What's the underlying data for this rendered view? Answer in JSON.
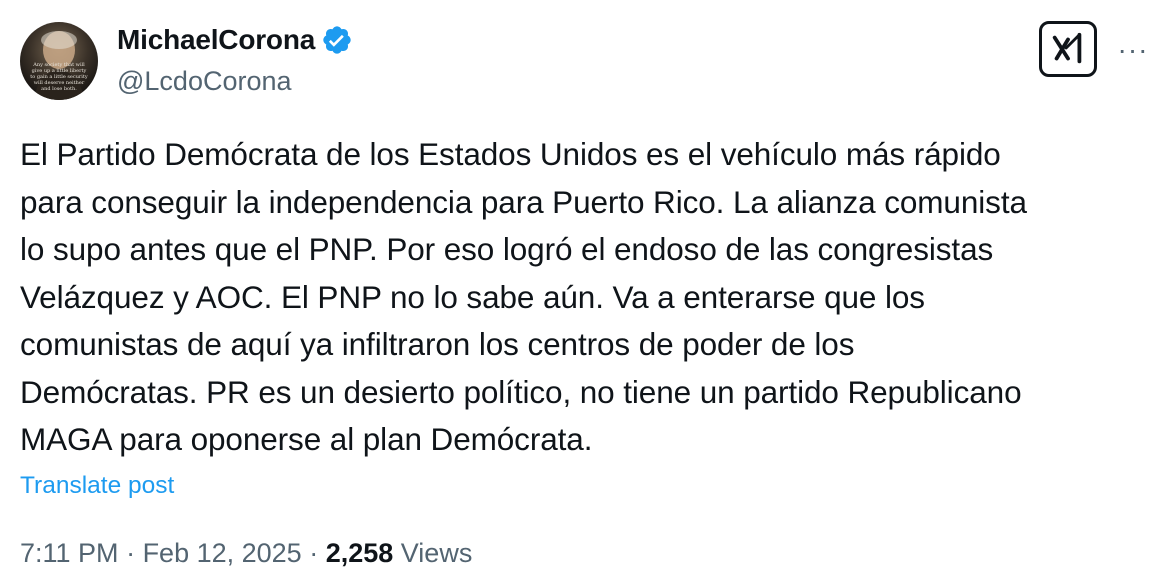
{
  "author": {
    "display_name": "MichaelCorona",
    "handle": "@LcdoCorona",
    "verified": true,
    "verified_color": "#1d9bf0",
    "avatar_caption": "Any society that will give up a little liberty to gain a little security will deserve neither and lose both."
  },
  "header": {
    "grok_icon": "grok-icon",
    "more_icon": "more-icon",
    "more_label": "···"
  },
  "post": {
    "lines": [
      "El Partido Demócrata de los Estados Unidos es el vehículo más rápido",
      "para conseguir la independencia para Puerto Rico. La alianza comunista",
      "lo supo antes que el PNP. Por eso logró el endoso de las congresistas",
      "Velázquez y AOC. El PNP no lo sabe aún. Va a enterarse que los",
      "comunistas de aquí ya infiltraron los centros de poder de los",
      "Demócratas. PR es un desierto político, no tiene un partido Republicano",
      "MAGA para oponerse al plan Demócrata."
    ],
    "translate_label": "Translate post"
  },
  "meta": {
    "time": "7:11 PM",
    "separator": " · ",
    "date": "Feb 12, 2025",
    "views_count": "2,258",
    "views_label": " Views"
  },
  "colors": {
    "text": "#0f1419",
    "secondary": "#536471",
    "link": "#1d9bf0"
  }
}
